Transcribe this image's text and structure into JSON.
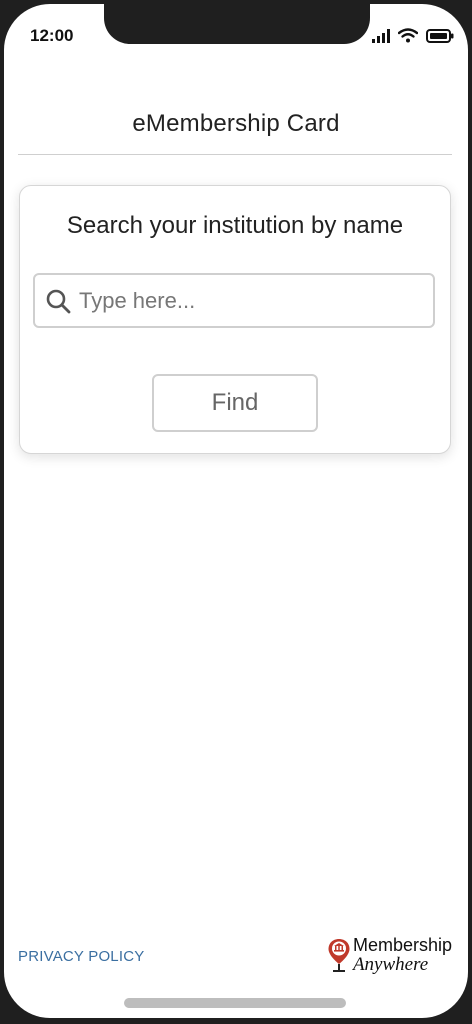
{
  "status_bar": {
    "time": "12:00",
    "icons": [
      "signal-icon",
      "wifi-icon",
      "battery-icon"
    ]
  },
  "header": {
    "title": "eMembership Card"
  },
  "search_card": {
    "title": "Search your institution by name",
    "search": {
      "placeholder": "Type here...",
      "value": "",
      "icon": "search-icon"
    },
    "find_label": "Find"
  },
  "footer": {
    "privacy_label": "PRIVACY POLICY",
    "brand_line1": "Membership",
    "brand_line2": "Anywhere",
    "brand_icon": "location-pin-icon"
  },
  "colors": {
    "link": "#3b6fa1",
    "border": "#cfcfcf",
    "text": "#222222",
    "brand_pin": "#c0392b"
  }
}
